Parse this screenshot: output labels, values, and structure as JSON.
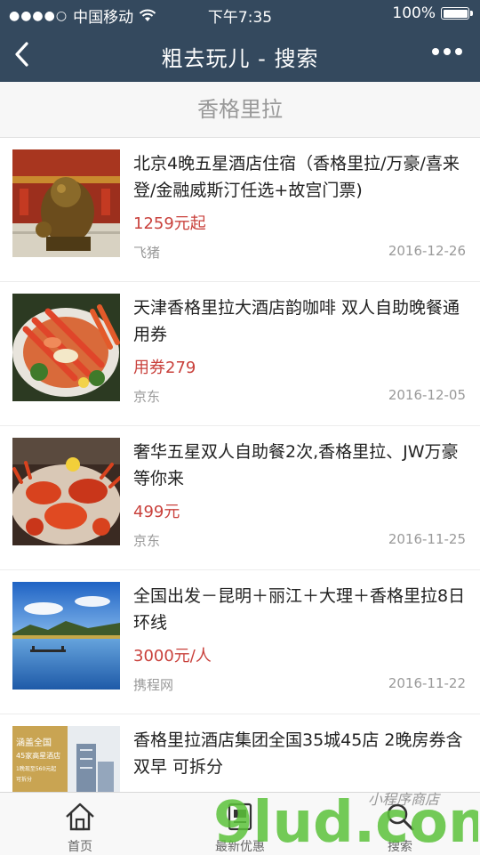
{
  "status_bar": {
    "carrier": "中国移动",
    "time": "下午7:35",
    "battery": "100%"
  },
  "nav": {
    "title": "粗去玩儿 - 搜索",
    "back_icon": "chevron-left-icon",
    "more_icon": "more-dots-icon"
  },
  "search": {
    "term": "香格里拉"
  },
  "results": [
    {
      "title": "北京4晚五星酒店住宿（香格里拉/万豪/喜来登/金融威斯汀任选+故宫门票)",
      "price": "1259元起",
      "source": "飞猪",
      "date": "2016-12-26",
      "thumb": "forbidden-city-lion"
    },
    {
      "title": "天津香格里拉大酒店韵咖啡 双人自助晚餐通用券",
      "price": "用券279",
      "source": "京东",
      "date": "2016-12-05",
      "thumb": "seafood-platter"
    },
    {
      "title": "奢华五星双人自助餐2次,香格里拉、JW万豪等你来",
      "price": "499元",
      "source": "京东",
      "date": "2016-11-25",
      "thumb": "crab-buffet"
    },
    {
      "title": "全国出发－昆明＋丽江＋大理＋香格里拉8日环线",
      "price": "3000元/人",
      "source": "携程网",
      "date": "2016-11-22",
      "thumb": "lake-landscape"
    },
    {
      "title": "香格里拉酒店集团全国35城45店 2晚房券含双早 可拆分",
      "price": "",
      "source": "",
      "date": "",
      "thumb": "hotel-promo",
      "thumb_text": [
        "涵盖全国",
        "45家高星酒店",
        "1晚现至560元起",
        "可拆分"
      ]
    }
  ],
  "tabbar": {
    "tabs": [
      {
        "label": "首页",
        "icon": "home-icon"
      },
      {
        "label": "最新优惠",
        "icon": "ticket-icon"
      },
      {
        "label": "搜索",
        "icon": "search-icon"
      }
    ]
  },
  "watermark": {
    "text": "9lud.com",
    "subtext": "小程序商店"
  },
  "colors": {
    "nav_bg": "#34495e",
    "price": "#c9413c",
    "meta_text": "#999999",
    "watermark_green": "#5cc23b",
    "watermark_orange": "#f08a24"
  }
}
